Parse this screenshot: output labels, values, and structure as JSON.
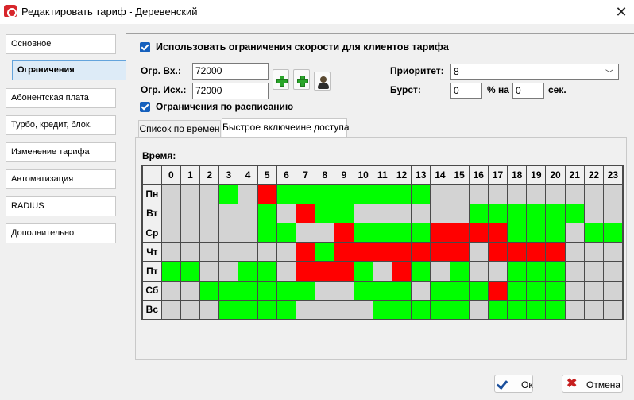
{
  "window": {
    "title": "Редактировать тариф - Деревенский",
    "brand_color": "#d7262b"
  },
  "sidebar": {
    "items": [
      {
        "label": "Основное",
        "active": false
      },
      {
        "label": "Ограничения",
        "active": true
      },
      {
        "label": "Абонентская плата",
        "active": false
      },
      {
        "label": "Турбо, кредит, блок.",
        "active": false
      },
      {
        "label": "Изменение тарифа",
        "active": false
      },
      {
        "label": "Автоматизация",
        "active": false
      },
      {
        "label": "RADIUS",
        "active": false
      },
      {
        "label": "Дополнительно",
        "active": false
      }
    ]
  },
  "limits": {
    "use_speed_limit_label": "Использовать ограничения скорости для клиентов тарифа",
    "use_speed_limit_checked": true,
    "in_label": "Огр. Вх.:",
    "in_value": "72000",
    "out_label": "Огр. Исх.:",
    "out_value": "72000",
    "priority_label": "Приоритет:",
    "priority_value": "8",
    "burst_label": "Бурст:",
    "burst_percent_value": "0",
    "burst_percent_unit": "% на",
    "burst_seconds_value": "0",
    "burst_seconds_unit": "сек.",
    "schedule_label": "Ограничения по расписанию",
    "schedule_checked": true
  },
  "tabs": [
    {
      "label": "Список по времен",
      "active": false
    },
    {
      "label": "Быстрое включеине доступа",
      "active": true
    }
  ],
  "schedule": {
    "time_label": "Время:",
    "hours": [
      "0",
      "1",
      "2",
      "3",
      "4",
      "5",
      "6",
      "7",
      "8",
      "9",
      "10",
      "11",
      "12",
      "13",
      "14",
      "15",
      "16",
      "17",
      "18",
      "19",
      "20",
      "21",
      "22",
      "23"
    ],
    "legend_colors": {
      "off": "#d3d3d3",
      "on": "#00ff00",
      "limited": "#ff0000"
    },
    "days": [
      {
        "label": "Пн",
        "cells": [
          0,
          0,
          0,
          1,
          0,
          2,
          1,
          1,
          1,
          1,
          1,
          1,
          1,
          1,
          0,
          0,
          0,
          0,
          0,
          0,
          0,
          0,
          0,
          0
        ]
      },
      {
        "label": "Вт",
        "cells": [
          0,
          0,
          0,
          0,
          0,
          1,
          0,
          2,
          1,
          1,
          0,
          0,
          0,
          0,
          0,
          0,
          1,
          1,
          1,
          1,
          1,
          1,
          0,
          0
        ]
      },
      {
        "label": "Ср",
        "cells": [
          0,
          0,
          0,
          0,
          0,
          1,
          1,
          0,
          0,
          2,
          1,
          1,
          1,
          1,
          2,
          2,
          2,
          2,
          1,
          1,
          1,
          0,
          1,
          1
        ]
      },
      {
        "label": "Чт",
        "cells": [
          0,
          0,
          0,
          0,
          0,
          0,
          0,
          2,
          1,
          2,
          2,
          2,
          2,
          2,
          2,
          2,
          0,
          2,
          2,
          2,
          2,
          0,
          0,
          0
        ]
      },
      {
        "label": "Пт",
        "cells": [
          1,
          1,
          0,
          0,
          1,
          1,
          0,
          2,
          2,
          2,
          1,
          0,
          2,
          1,
          0,
          1,
          0,
          0,
          1,
          1,
          1,
          0,
          0,
          0
        ]
      },
      {
        "label": "Сб",
        "cells": [
          0,
          0,
          1,
          1,
          1,
          1,
          1,
          1,
          0,
          0,
          1,
          1,
          1,
          0,
          1,
          1,
          1,
          2,
          1,
          1,
          1,
          0,
          0,
          0
        ]
      },
      {
        "label": "Вс",
        "cells": [
          0,
          0,
          0,
          1,
          1,
          1,
          1,
          0,
          0,
          0,
          0,
          1,
          1,
          1,
          1,
          1,
          0,
          1,
          1,
          1,
          1,
          0,
          0,
          0
        ]
      }
    ]
  },
  "footer": {
    "ok_label": "Ок",
    "cancel_label": "Отмена"
  }
}
